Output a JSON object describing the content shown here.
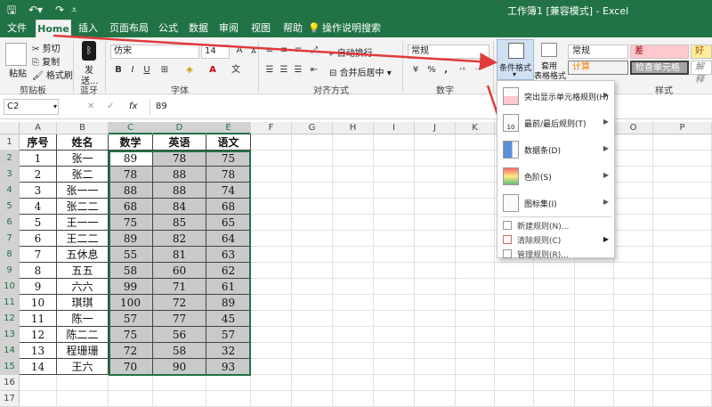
{
  "window": {
    "title": "工作簿1 [兼容模式] - Excel"
  },
  "tabs": [
    "文件",
    "Home",
    "插入",
    "页面布局",
    "公式",
    "数据",
    "审阅",
    "视图",
    "帮助"
  ],
  "tell_me": "操作说明搜索",
  "ribbon": {
    "clipboard": {
      "paste": "粘贴",
      "cut": "剪切",
      "copy": "复制",
      "format_painter": "格式刷",
      "label": "剪贴板"
    },
    "bluetooth": {
      "send": "发",
      "send2": "送...",
      "label": "蓝牙"
    },
    "font": {
      "name": "仿宋",
      "size": "14",
      "label": "字体",
      "bold": "B",
      "italic": "I",
      "underline": "U",
      "grow": "A",
      "shrink": "A",
      "wen": "文"
    },
    "alignment": {
      "wrap": "自动换行",
      "merge": "合并后居中",
      "label": "对齐方式"
    },
    "number": {
      "format": "常规",
      "label": "数字",
      "percent": "%",
      "comma": ","
    },
    "styles": {
      "conditional": "条件格式",
      "table": "套用",
      "table2": "表格格式",
      "normal": "常规",
      "bad": "差",
      "good": "好",
      "calc": "计算",
      "check": "检查单元格",
      "explain": "解释",
      "label": "样式"
    }
  },
  "formula_bar": {
    "name_box": "C2",
    "value": "89",
    "fx": "fx",
    "cancel": "✕",
    "enter": "✓"
  },
  "columns": [
    "A",
    "B",
    "C",
    "D",
    "E",
    "F",
    "G",
    "H",
    "I",
    "J",
    "K",
    "L",
    "M",
    "N",
    "O",
    "P"
  ],
  "rows": [
    "1",
    "2",
    "3",
    "4",
    "5",
    "6",
    "7",
    "8",
    "9",
    "10",
    "11",
    "12",
    "13",
    "14",
    "15",
    "16",
    "17"
  ],
  "table": {
    "headers": [
      "序号",
      "姓名",
      "数学",
      "英语",
      "语文"
    ],
    "rows": [
      [
        "1",
        "张一",
        "89",
        "78",
        "75"
      ],
      [
        "2",
        "张二",
        "78",
        "88",
        "78"
      ],
      [
        "3",
        "张一一",
        "88",
        "88",
        "74"
      ],
      [
        "4",
        "张二二",
        "68",
        "84",
        "68"
      ],
      [
        "5",
        "王一一",
        "75",
        "85",
        "65"
      ],
      [
        "6",
        "王二二",
        "89",
        "82",
        "64"
      ],
      [
        "7",
        "五休息",
        "55",
        "81",
        "63"
      ],
      [
        "8",
        "五五",
        "58",
        "60",
        "62"
      ],
      [
        "9",
        "六六",
        "99",
        "71",
        "61"
      ],
      [
        "10",
        "琪琪",
        "100",
        "72",
        "89"
      ],
      [
        "11",
        "陈一",
        "57",
        "77",
        "45"
      ],
      [
        "12",
        "陈二二",
        "75",
        "56",
        "57"
      ],
      [
        "13",
        "程珊珊",
        "72",
        "58",
        "32"
      ],
      [
        "14",
        "王六",
        "70",
        "90",
        "93"
      ]
    ]
  },
  "menu": {
    "items": [
      "突出显示单元格规则(H)",
      "最前/最后规则(T)",
      "数据条(D)",
      "色阶(S)",
      "图标集(I)"
    ],
    "small_items": [
      "新建规则(N)...",
      "清除规则(C)",
      "管理规则(R)..."
    ],
    "ten_badge": "10"
  },
  "colors": {
    "accent": "#217346",
    "arrow": "#e03b3b",
    "selected_gray": "#c9c9c9"
  }
}
